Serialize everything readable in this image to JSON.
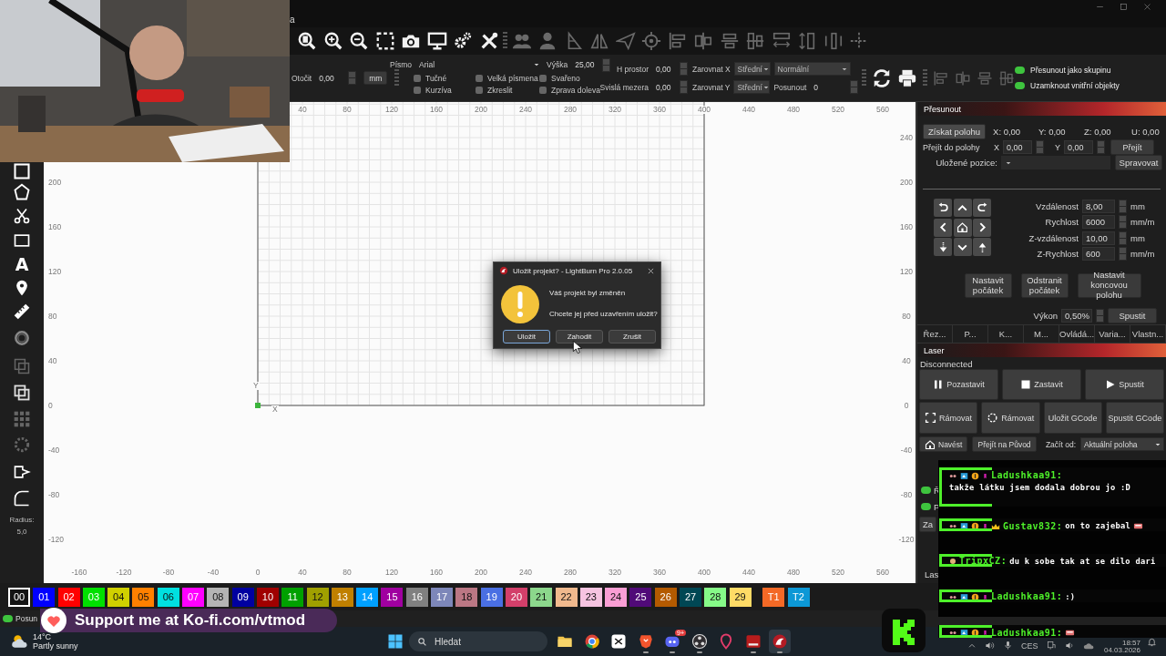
{
  "title_bar": {
    "menu_fragment": "a"
  },
  "toolbar": {
    "buttons": [
      {
        "disabled": false
      },
      {
        "disabled": false
      },
      {
        "disabled": false
      },
      {
        "disabled": false
      },
      {
        "disabled": false
      },
      {
        "disabled": false
      },
      {
        "disabled": false
      },
      {
        "disabled": false
      },
      {
        "disabled": true
      },
      {
        "disabled": true
      },
      {
        "disabled": true
      },
      {
        "disabled": true
      },
      {
        "disabled": true
      },
      {
        "disabled": true
      },
      {
        "disabled": true
      },
      {
        "disabled": true
      },
      {
        "disabled": true
      },
      {
        "disabled": true
      },
      {
        "disabled": true
      },
      {
        "disabled": true
      },
      {
        "disabled": true
      },
      {
        "disabled": true
      }
    ]
  },
  "properties": {
    "rotate": {
      "label": "Otočit",
      "value": "0,00"
    },
    "unit_button": "mm",
    "font": {
      "label": "Písmo",
      "value": "Arial"
    },
    "height": {
      "label": "Výška",
      "value": "25,00"
    },
    "options": [
      {
        "label": "Tučné",
        "checked": false
      },
      {
        "label": "Velká písmena",
        "checked": false
      },
      {
        "label": "Svařeno",
        "checked": false
      },
      {
        "label": "Kurzíva",
        "checked": false
      },
      {
        "label": "Zkreslit",
        "checked": false
      },
      {
        "label": "Zprava doleva",
        "checked": false
      }
    ],
    "h_spacing": {
      "label": "H prostor",
      "value": "0,00"
    },
    "v_spacing": {
      "label": "Svislá mezera",
      "value": "0,00"
    },
    "align_x": {
      "label": "Zarovnat X",
      "value": "Střední"
    },
    "style": {
      "value": "Normální"
    },
    "align_y": {
      "label": "Zarovnat Y",
      "value": "Střední"
    },
    "offset": {
      "label": "Posunout",
      "value": "0"
    },
    "toggles": [
      {
        "label": "Přesunout jako skupinu",
        "on": true
      },
      {
        "label": "Uzamknout vnitřní objekty",
        "on": true
      }
    ]
  },
  "left_tools": {
    "text_tool": "A",
    "radius_label": "Radius:",
    "radius_value": "5,0"
  },
  "canvas": {
    "top_ruler": [
      "40",
      "80",
      "120",
      "160",
      "200",
      "240",
      "280",
      "320",
      "360",
      "400",
      "440",
      "480",
      "520",
      "560"
    ],
    "left_ruler": [
      "200",
      "160",
      "120",
      "80",
      "40",
      "0",
      "-40",
      "-80",
      "-120"
    ],
    "right_ruler": [
      "240",
      "200",
      "160",
      "120",
      "80",
      "40",
      "0",
      "-40",
      "-80",
      "-120"
    ],
    "bottom_ruler": [
      "-160",
      "-120",
      "-80",
      "-40",
      "0",
      "40",
      "80",
      "120",
      "160",
      "200",
      "240",
      "280",
      "320",
      "360",
      "400",
      "440",
      "480",
      "520",
      "560"
    ],
    "axis_y": "Y",
    "axis_x": "X"
  },
  "move_panel": {
    "title": "Přesunout",
    "get_position": "Získat polohu",
    "coords": [
      "X: 0,00",
      "Y: 0,00",
      "Z: 0,00",
      "U: 0,00"
    ],
    "goto_label": "Přejít do polohy",
    "goto_x": {
      "label": "X",
      "value": "0,00"
    },
    "goto_y": {
      "label": "Y",
      "value": "0,00"
    },
    "goto_button": "Přejít",
    "saved_label": "Uložené pozice:",
    "manage_button": "Spravovat",
    "jog": [
      {
        "label": "Vzdálenost",
        "value": "8,00",
        "unit": "mm"
      },
      {
        "label": "Rychlost",
        "value": "6000",
        "unit": "mm/m"
      },
      {
        "label": "Z-vzdálenost",
        "value": "10,00",
        "unit": "mm"
      },
      {
        "label": "Z-Rychlost",
        "value": "600",
        "unit": "mm/m"
      }
    ],
    "origin_buttons": [
      "Nastavit počátek",
      "Odstranit počátek",
      "Nastavit koncovou polohu"
    ],
    "power_label": "Výkon",
    "power_value": "0,50%",
    "fire_button": "Spustit",
    "tabs": [
      {
        "label": "Řez...",
        "selected": false
      },
      {
        "label": "P...",
        "selected": false
      },
      {
        "label": "K...",
        "selected": false
      },
      {
        "label": "M...",
        "selected": false
      },
      {
        "label": "Ovládá...",
        "selected": false
      },
      {
        "label": "Varia...",
        "selected": false
      },
      {
        "label": "Vlastn...",
        "selected": false
      }
    ]
  },
  "laser_panel": {
    "title": "Laser",
    "status": "Disconnected",
    "run_buttons": [
      "Pozastavit",
      "Zastavit",
      "Spustit"
    ],
    "frame_buttons": [
      "Rámovat",
      "Rámovat",
      "Uložit GCode",
      "Spustit GCode"
    ],
    "home_button": "Navést",
    "goto_origin_button": "Přejít na Původ",
    "start_from_label": "Začít od:",
    "start_from_value": "Aktuální poloha",
    "option_toggles": [
      {
        "label": "Ř",
        "on": true
      },
      {
        "label": "P",
        "on": true
      }
    ],
    "device_button": "Za",
    "bottom_tab": "Las"
  },
  "palette": [
    {
      "label": "00",
      "color": "#141414",
      "selected": true
    },
    {
      "label": "01",
      "color": "#0000ff",
      "selected": false
    },
    {
      "label": "02",
      "color": "#ff0000",
      "selected": false
    },
    {
      "label": "03",
      "color": "#00e000",
      "selected": false
    },
    {
      "label": "04",
      "color": "#d0d000",
      "selected": false
    },
    {
      "label": "05",
      "color": "#ff8000",
      "selected": false
    },
    {
      "label": "06",
      "color": "#00e0e0",
      "selected": false
    },
    {
      "label": "07",
      "color": "#ff00ff",
      "selected": false
    },
    {
      "label": "08",
      "color": "#b4b4b4",
      "selected": false
    },
    {
      "label": "09",
      "color": "#0000a0",
      "selected": false
    },
    {
      "label": "10",
      "color": "#a00000",
      "selected": false
    },
    {
      "label": "11",
      "color": "#00a000",
      "selected": false
    },
    {
      "label": "12",
      "color": "#a0a000",
      "selected": false
    },
    {
      "label": "13",
      "color": "#c08000",
      "selected": false
    },
    {
      "label": "14",
      "color": "#00a0ff",
      "selected": false
    },
    {
      "label": "15",
      "color": "#a000a0",
      "selected": false
    },
    {
      "label": "16",
      "color": "#808080",
      "selected": false
    },
    {
      "label": "17",
      "color": "#7d87b9",
      "selected": false
    },
    {
      "label": "18",
      "color": "#bb7784",
      "selected": false
    },
    {
      "label": "19",
      "color": "#4a6fe3",
      "selected": false
    },
    {
      "label": "20",
      "color": "#d33f6a",
      "selected": false
    },
    {
      "label": "21",
      "color": "#8cd78c",
      "selected": false
    },
    {
      "label": "22",
      "color": "#f0b98d",
      "selected": false
    },
    {
      "label": "23",
      "color": "#f6c4e1",
      "selected": false
    },
    {
      "label": "24",
      "color": "#fa9ed4",
      "selected": false
    },
    {
      "label": "25",
      "color": "#500a78",
      "selected": false
    },
    {
      "label": "26",
      "color": "#b45a00",
      "selected": false
    },
    {
      "label": "27",
      "color": "#004754",
      "selected": false
    },
    {
      "label": "28",
      "color": "#86fa88",
      "selected": false
    },
    {
      "label": "29",
      "color": "#ffdb66",
      "selected": false
    },
    {
      "label": "T1",
      "color": "#f36926",
      "selected": false
    },
    {
      "label": "T2",
      "color": "#0c98d6",
      "selected": false
    }
  ],
  "status_bar": {
    "toggle_on": true,
    "text": "Posun"
  },
  "kofi_banner": {
    "text": "Support me at Ko-fi.com/vtmod"
  },
  "taskbar": {
    "temperature": "14°C",
    "weather": "Partly sunny",
    "search_placeholder": "Hledat",
    "apps": [
      {
        "running": false,
        "active": false
      },
      {
        "running": false,
        "active": false
      },
      {
        "running": false,
        "active": false
      },
      {
        "running": true,
        "active": false
      },
      {
        "running": true,
        "active": false,
        "badge": "9+"
      },
      {
        "running": true,
        "active": false
      },
      {
        "running": false,
        "active": false
      },
      {
        "running": true,
        "active": false
      },
      {
        "running": true,
        "active": true
      }
    ],
    "tray": {
      "language": "CES",
      "time": "18:57",
      "date": "04.03.2026"
    }
  },
  "dialog": {
    "title": "Uložit projekt? - LightBurn Pro 2.0.05",
    "lines": [
      "Váš projekt byl změněn",
      "Chcete jej před uzavřením uložit?"
    ],
    "buttons": [
      {
        "label": "Uložit",
        "selected": true
      },
      {
        "label": "Zahodit",
        "selected": false
      },
      {
        "label": "Zrušit",
        "selected": false
      }
    ]
  },
  "chat": [
    {
      "user": "Ladushkaa91:",
      "text": "takže látku jsem dodala dobrou jo :D",
      "kind": "sub",
      "crown": false,
      "emote": false,
      "wrapped": true
    },
    {
      "user": "Gustav832:",
      "text": "on to zajebal",
      "kind": "sub",
      "crown": true,
      "emote": true,
      "wrapped": false
    },
    {
      "user": "TripxCZ:",
      "text": "du k sobe tak at se dilo dari",
      "kind": "plain",
      "crown": false,
      "emote": false,
      "wrapped": false
    },
    {
      "user": "Ladushkaa91:",
      "text": ":)",
      "kind": "sub",
      "crown": false,
      "emote": false,
      "wrapped": false
    },
    {
      "user": "Ladushkaa91:",
      "kind": "sub",
      "crown": false,
      "emote": true,
      "wrapped": false
    }
  ]
}
